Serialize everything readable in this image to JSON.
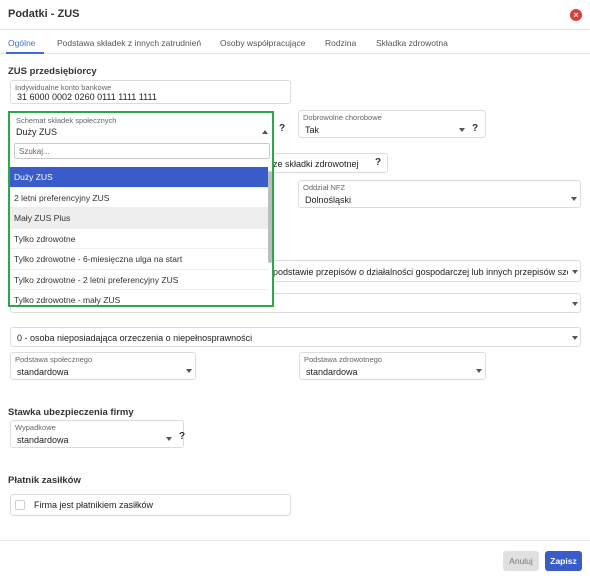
{
  "window": {
    "title": "Podatki - ZUS"
  },
  "tabs": [
    "Ogólne",
    "Podstawa składek z innych zatrudnień",
    "Osoby współpracujące",
    "Rodzina",
    "Składka zdrowotna"
  ],
  "zus": {
    "section_title": "ZUS przedsiębiorcy",
    "account_label": "Indywidualne konto bankowe",
    "account_value": "31 6000 0002 0260 0111 1111 1111",
    "scheme_label": "Schemat składek społecznych",
    "scheme_value": "Duży ZUS",
    "voluntary_label": "Dobrowolne chorobowe",
    "voluntary_value": "Tak",
    "health_btn_text": "ze składki zdrowotnej",
    "nfz_label": "Oddział NFZ",
    "nfz_value": "Dolnośląski",
    "basis_text": "podstawie przepisów o działalności gospodarczej lub innych przepisów szcz...",
    "disability_value": "0 - osoba nieposiadająca orzeczenia o niepełnosprawności",
    "social_basis_label": "Podstawa społecznego",
    "social_basis_value": "standardowa",
    "health_basis_label": "Podstawa zdrowotnego",
    "health_basis_value": "standardowa"
  },
  "dropdown": {
    "search_placeholder": "Szukaj...",
    "options": [
      "Duży ZUS",
      "2 letni preferencyjny ZUS",
      "Mały ZUS Plus",
      "Tylko zdrowotne",
      "Tylko zdrowotne - 6-miesięczna ulga na start",
      "Tylko zdrowotne - 2 letni preferencyjny ZUS",
      "Tylko zdrowotne - mały ZUS"
    ],
    "selected": "Duży ZUS",
    "hovered": "Mały ZUS Plus"
  },
  "insurance": {
    "section_title": "Stawka ubezpieczenia firmy",
    "accident_label": "Wypadkowe",
    "accident_value": "standardowa"
  },
  "payer": {
    "section_title": "Płatnik zasiłków",
    "checkbox_label": "Firma jest płatnikiem zasiłków"
  },
  "buttons": {
    "cancel": "Anuluj",
    "save": "Zapisz"
  },
  "help_mark": "?",
  "close_mark": "×",
  "colors": {
    "accent": "#3a5cc9",
    "highlight": "#2aa84a",
    "close": "#e03c3c"
  }
}
